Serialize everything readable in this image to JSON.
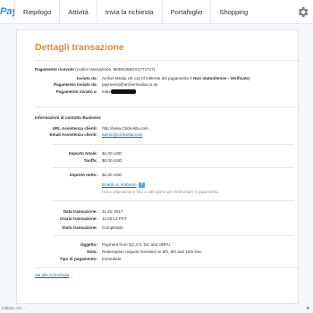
{
  "nav": {
    "logo": "PayPal",
    "items": [
      "Riepilogo",
      "Attività",
      "Invia la richiesta",
      "Portafoglio",
      "Shopping"
    ]
  },
  "title": "Dettagli transazione",
  "payment": {
    "received_label": "Pagamento ricevuto",
    "received_code": "(codice transazione: 96360455UG1771717)",
    "sent_by_label": "Inviato da:",
    "sent_by_value": "Archer Media UK Ltd (Il mittente del pagamento è",
    "sent_by_status": "Non statunitense - Verificato",
    "sent_by_close": ")",
    "sent_from_label": "Pagamento inviato da:",
    "sent_from_value": "payments@archermedia.co.uk",
    "sent_to_label": "Pagamento inviato a:",
    "sent_to_value": "mikv"
  },
  "business": {
    "heading": "Informazioni di contatto Business",
    "url_label": "URL Assistenza clienti:",
    "url_value": "http://www.Clickvista.com",
    "email_label": "Email Assistenza clienti:",
    "email_value": "admin@clickvista.com"
  },
  "amounts": {
    "total_label": "Importo totale:",
    "total_value": "$1,00 USD",
    "fee_label": "Tariffa:",
    "fee_value": "$0,00 USD",
    "net_label": "Importo netto:",
    "net_value": "$1,00 USD",
    "refund_link": "Emetti un rimborso",
    "help": "?",
    "refund_note": "Hai a disposizione fino a 180 giorni per rimborsare il pagamento."
  },
  "details": {
    "date_label": "Data transazione:",
    "date_value": "11 dic 2017",
    "time_label": "Orario transazione:",
    "time_value": "11:20:13 PST",
    "status_label": "Stato transazione:",
    "status_value": "Completato"
  },
  "subject": {
    "object_label": "Oggetto:",
    "object_value": "Payment from QC,CV, DC and ORFU",
    "note_label": "Nota:",
    "note_value": "Redemption request received on 8th, 9th and 10th Dec",
    "type_label": "Tipo di pagamento:",
    "type_value": "Immediato"
  },
  "history_link": "Vai alla Cronologia",
  "footer_text": "Indietro Ch..."
}
